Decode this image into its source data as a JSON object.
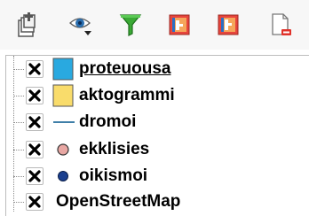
{
  "toolbar": {
    "buttons": [
      {
        "icon": "add-group-icon"
      },
      {
        "icon": "manage-visibility-icon"
      },
      {
        "icon": "filter-legend-icon"
      },
      {
        "icon": "expand-all-icon"
      },
      {
        "icon": "collapse-all-icon"
      },
      {
        "icon": "remove-layer-icon"
      }
    ]
  },
  "layers": [
    {
      "name": "proteuousa",
      "checked": true,
      "symbol": "square",
      "color": "#29a9e0",
      "underline": true
    },
    {
      "name": "aktogrammi",
      "checked": true,
      "symbol": "square",
      "color": "#f9dc6b",
      "underline": false
    },
    {
      "name": "dromoi",
      "checked": true,
      "symbol": "line",
      "color": "#3f7fa8",
      "underline": false
    },
    {
      "name": "ekklisies",
      "checked": true,
      "symbol": "circle",
      "color": "#e8a7a3",
      "underline": false
    },
    {
      "name": "oikismoi",
      "checked": true,
      "symbol": "circle",
      "color": "#1a3f8f",
      "underline": false
    },
    {
      "name": "OpenStreetMap",
      "checked": true,
      "symbol": "none",
      "color": "",
      "underline": false
    }
  ]
}
